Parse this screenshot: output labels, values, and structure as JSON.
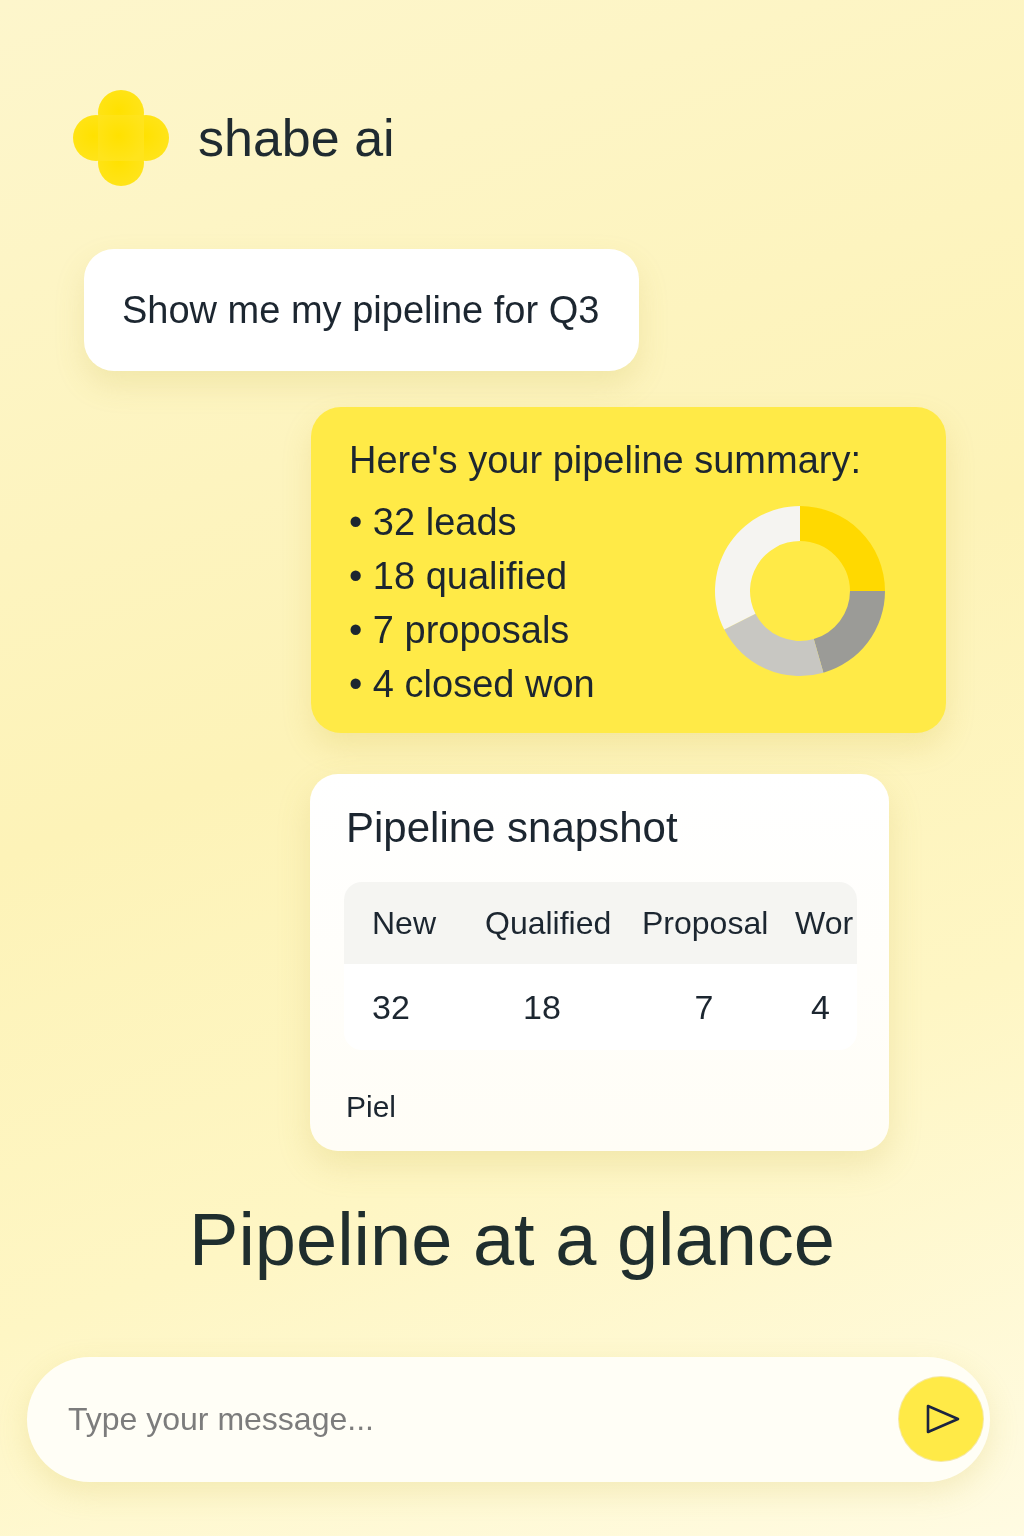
{
  "app": {
    "name": "shabe ai"
  },
  "messages": [
    {
      "kind": "user",
      "text": "Show me my pipeline for Q3"
    },
    {
      "kind": "assistant",
      "title": "Here's your pipeline summary:",
      "bullets": [
        "• 32 leads",
        "• 18 qualified",
        "• 7 proposals",
        "• 4 closed won"
      ]
    }
  ],
  "snapshot": {
    "title": "Pipeline snapshot",
    "table": {
      "columns": [
        "New",
        "Qualified",
        "Proposal",
        "Wor"
      ],
      "rows": [
        [
          "32",
          "18",
          "7",
          "4"
        ]
      ]
    },
    "footer": "Piel"
  },
  "heading": "Pipeline at a glance",
  "composer": {
    "placeholder": "Type your message..."
  }
}
